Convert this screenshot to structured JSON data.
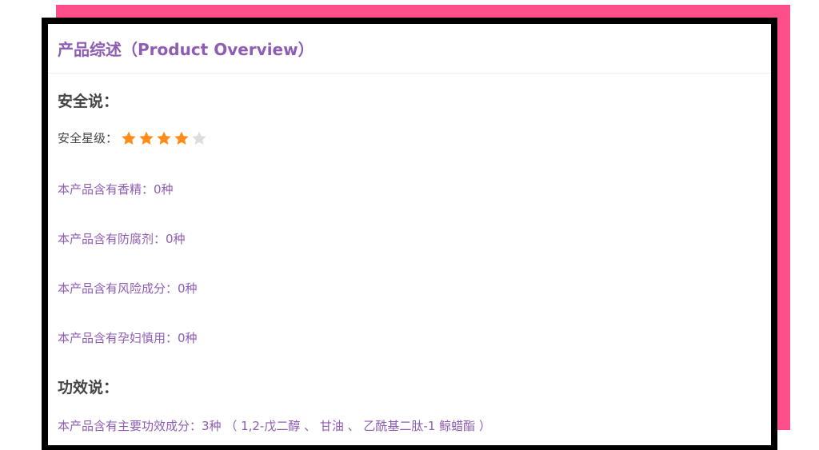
{
  "card": {
    "title": "产品综述（Product Overview）"
  },
  "safety_section": {
    "heading": "安全说：",
    "rating_label": "安全星级：",
    "rating": 4,
    "rating_max": 5,
    "star_color_filled": "#ff8c1a",
    "star_color_empty": "#dddddd",
    "lines": [
      "本产品含有香精：0种",
      "本产品含有防腐剂：0种",
      "本产品含有风险成分：0种",
      "本产品含有孕妇慎用：0种"
    ]
  },
  "efficacy_section": {
    "heading": "功效说：",
    "lines": [
      "本产品含有主要功效成分：3种 （ 1,2-戊二醇 、 甘油 、 乙酰基二肽-1 鲸蜡酯 ）"
    ]
  },
  "colors": {
    "accent_purple": "#8e5db3",
    "pink_backdrop": "#ff4f8b",
    "frame_black": "#000000"
  }
}
